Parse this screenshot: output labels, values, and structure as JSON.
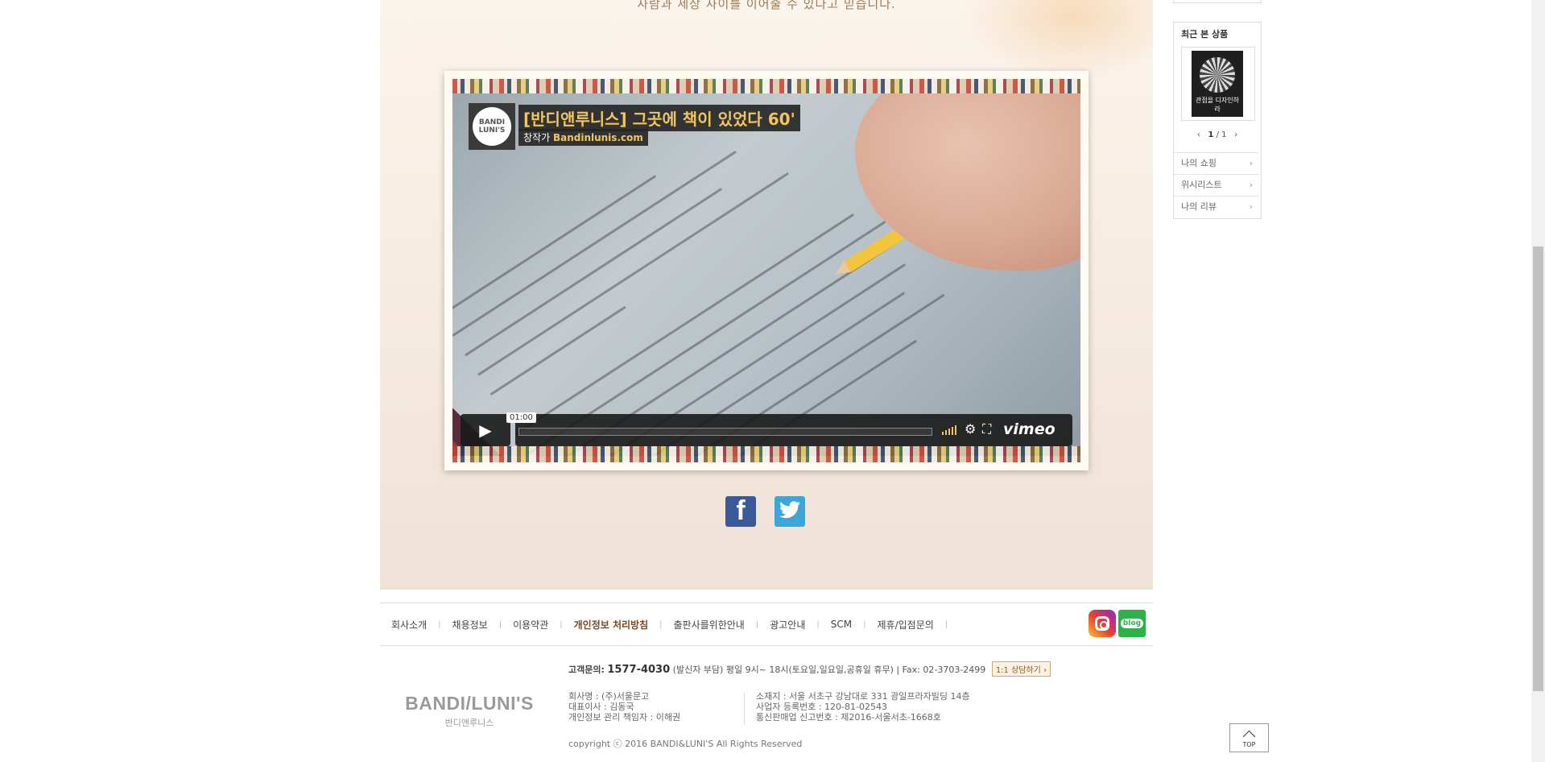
{
  "intro": {
    "text": "사람과 세상 사이를 이어줄 수 있다고 믿습니다."
  },
  "video": {
    "badge_line1": "BANDI",
    "badge_line2": "LUNI'S",
    "title": "[반디앤루니스] 그곳에 책이 있었다 60'",
    "byline_prefix": "창작가",
    "byline_name": "Bandinlunis.com",
    "time": "01:00",
    "brand": "vimeo"
  },
  "social": {
    "facebook": "f",
    "twitter": "t"
  },
  "sidebar": {
    "recent_title": "최근 본 상품",
    "book_title": "관점을 디자인하라",
    "pager_current": "1",
    "pager_total": "/ 1",
    "links": [
      "나의 쇼핑",
      "위시리스트",
      "나의 리뷰"
    ],
    "link_chevron": "›"
  },
  "footer": {
    "nav": [
      {
        "label": "회사소개"
      },
      {
        "label": "채용정보"
      },
      {
        "label": "이용약관"
      },
      {
        "label": "개인정보 처리방침",
        "strong": true
      },
      {
        "label": "출판사를위한안내"
      },
      {
        "label": "광고안내"
      },
      {
        "label": "SCM"
      },
      {
        "label": "제휴/입점문의"
      }
    ],
    "separator": "|",
    "cs_label": "고객문의:",
    "cs_number": "1577-4030",
    "cs_detail": "(발신자 부담) 평일 9시~ 18시(토요일,일요일,공휴일 휴무) | Fax: 02-3703-2499",
    "cs_chat": "1:1 상담하기 ›",
    "logo_en": "BANDI/LUNI'S",
    "logo_ko": "반디앤루니스",
    "info_left": [
      "회사명 : (주)서울문고",
      "대표이사 : 김동국",
      "개인정보 관리 책임자 : 이해권"
    ],
    "info_right": [
      "소재지 : 서울 서초구 강남대로 331 광일프라자빌딩 14층",
      "사업자 등록번호 : 120-81-02543",
      "통신판매업 신고번호 : 제2016-서울서초-1668호"
    ],
    "copyright": "copyright ⓒ 2016 BANDI&LUNI'S All Rights Reserved",
    "blog_label": "blog",
    "top_label": "TOP"
  }
}
